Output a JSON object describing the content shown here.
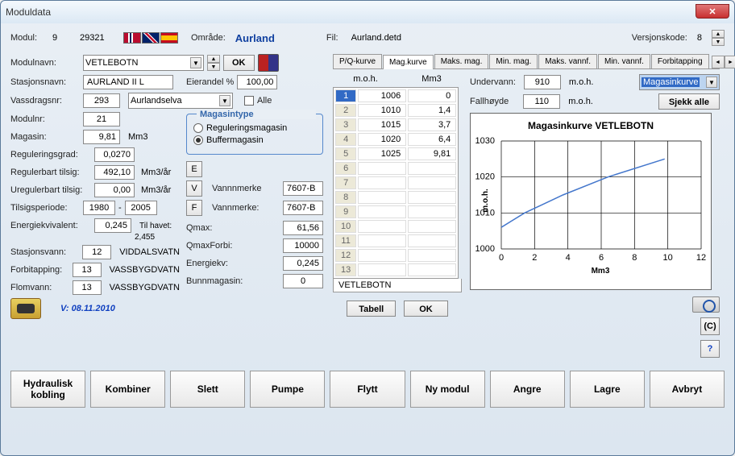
{
  "window": {
    "title": "Moduldata"
  },
  "header": {
    "modul_label": "Modul:",
    "modul_value": "9",
    "modul_code": "29321",
    "omrade_label": "Område:",
    "omrade_value": "Aurland",
    "fil_label": "Fil:",
    "fil_value": "Aurland.detd",
    "versjon_label": "Versjonskode:",
    "versjon_value": "8"
  },
  "left": {
    "modulnavn_label": "Modulnavn:",
    "modulnavn_value": "VETLEBOTN",
    "ok_label": "OK",
    "stasjonsnavn_label": "Stasjonsnavn:",
    "stasjonsnavn_value": "AURLAND II L",
    "eierandel_label": "Eierandel %",
    "eierandel_value": "100,00",
    "vassdrag_label": "Vassdragsnr:",
    "vassdrag_value": "293",
    "vassdrag_name": "Aurlandselva",
    "alle_label": "Alle",
    "modulnr_label": "Modulnr:",
    "modulnr_value": "21",
    "magasin_label": "Magasin:",
    "magasin_value": "9,81",
    "magasin_unit": "Mm3",
    "reggrad_label": "Reguleringsgrad:",
    "reggrad_value": "0,0270",
    "regtilsig_label": "Regulerbart tilsig:",
    "regtilsig_value": "492,10",
    "regtilsig_unit": "Mm3/år",
    "uregtilsig_label": "Uregulerbart tilsig:",
    "uregtilsig_value": "0,00",
    "uregtilsig_unit": "Mm3/år",
    "tilsigperiode_label": "Tilsigsperiode:",
    "tilsigperiode_from": "1980",
    "tilsigperiode_to": "2005",
    "energiekv_label": "Energiekvivalent:",
    "energiekv_value": "0,245",
    "tilhavet_label": "Til havet:",
    "tilhavet_value": "2,455",
    "stasjonsvann_label": "Stasjonsvann:",
    "stasjonsvann_value": "12",
    "stasjonsvann_name": "VIDDALSVATN",
    "forbitapping_label": "Forbitapping:",
    "forbitapping_value": "13",
    "forbitapping_name": "VASSBYGDVATN",
    "flomvann_label": "Flomvann:",
    "flomvann_value": "13",
    "flomvann_name": "VASSBYGDVATN",
    "version_text": "V: 08.11.2010",
    "magasintype": {
      "legend": "Magasintype",
      "opt1": "Reguleringsmagasin",
      "opt2": "Buffermagasin"
    },
    "e_btn": "E",
    "v_btn": "V",
    "f_btn": "F",
    "vannmerke1_label": "Vannnmerke",
    "vannmerke1_value": "7607-B",
    "vannmerke2_label": "Vannmerke:",
    "vannmerke2_value": "7607-B",
    "qmax_label": "Qmax:",
    "qmax_value": "61,56",
    "qmaxforbi_label": "QmaxForbi:",
    "qmaxforbi_value": "10000",
    "energiekv2_label": "Energiekv:",
    "energiekv2_value": "0,245",
    "bunnmagasin_label": "Bunnmagasin:",
    "bunnmagasin_value": "0"
  },
  "tabs": {
    "t1": "P/Q-kurve",
    "t2": "Mag.kurve",
    "t3": "Maks. mag.",
    "t4": "Min. mag.",
    "t5": "Maks. vannf.",
    "t6": "Min. vannf.",
    "t7": "Forbitapping"
  },
  "right": {
    "col1": "m.o.h.",
    "col2": "Mm3",
    "undervann_label": "Undervann:",
    "undervann_value": "910",
    "undervann_unit": "m.o.h.",
    "kurve_select": "Magasinkurve",
    "fallhoyde_label": "Fallhøyde",
    "fallhoyde_value": "110",
    "fallhoyde_unit": "m.o.h.",
    "sjekk_label": "Sjekk alle",
    "table_footer": "VETLEBOTN",
    "tabell_btn": "Tabell",
    "ok_btn": "OK",
    "c_btn": "(C)",
    "q_btn": "?",
    "rows": [
      {
        "n": "1",
        "a": "1006",
        "b": "0"
      },
      {
        "n": "2",
        "a": "1010",
        "b": "1,4"
      },
      {
        "n": "3",
        "a": "1015",
        "b": "3,7"
      },
      {
        "n": "4",
        "a": "1020",
        "b": "6,4"
      },
      {
        "n": "5",
        "a": "1025",
        "b": "9,81"
      }
    ]
  },
  "chart_data": {
    "type": "line",
    "title": "Magasinkurve VETLEBOTN",
    "xlabel": "Mm3",
    "ylabel": "m.o.h.",
    "xlim": [
      0,
      12
    ],
    "ylim": [
      1000,
      1030
    ],
    "x_ticks": [
      0,
      2,
      4,
      6,
      8,
      10,
      12
    ],
    "y_ticks": [
      1000,
      1010,
      1020,
      1030
    ],
    "x": [
      0,
      1.4,
      3.7,
      6.4,
      9.81
    ],
    "y": [
      1006,
      1010,
      1015,
      1020,
      1025
    ]
  },
  "bottom": {
    "b1": "Hydraulisk kobling",
    "b2": "Kombiner",
    "b3": "Slett",
    "b4": "Pumpe",
    "b5": "Flytt",
    "b6": "Ny modul",
    "b7": "Angre",
    "b8": "Lagre",
    "b9": "Avbryt"
  }
}
